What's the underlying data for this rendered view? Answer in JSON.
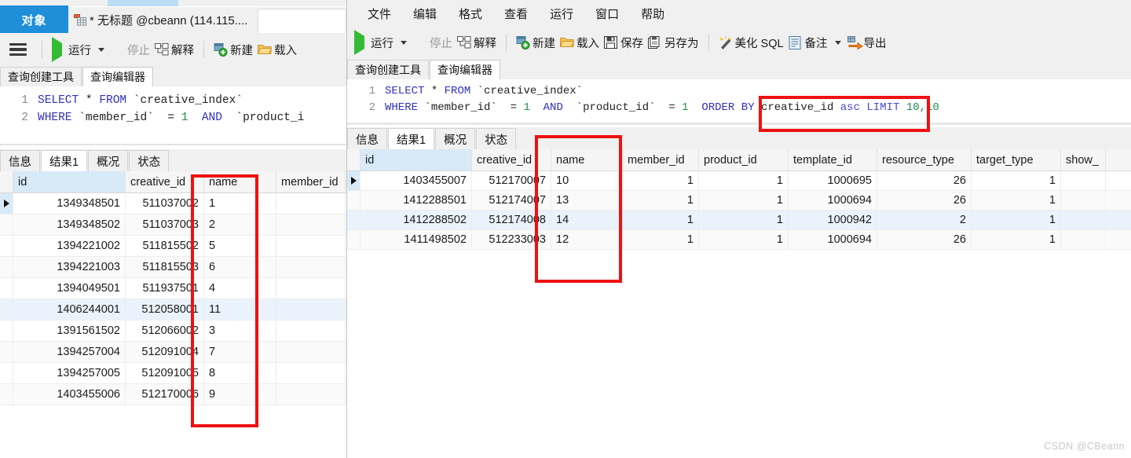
{
  "left_window": {
    "tabs": {
      "object_tab": "对象",
      "connection_tab": "* 无标题 @cbeann (114.115...."
    },
    "toolbar": {
      "menu_icon": "hamburger-icon",
      "run": "运行",
      "stop": "停止",
      "explain": "解释",
      "new": "新建",
      "load": "载入"
    },
    "subtabs": [
      {
        "label": "查询创建工具",
        "active": false
      },
      {
        "label": "查询编辑器",
        "active": true
      }
    ],
    "editor": {
      "lines": [
        {
          "n": "1",
          "tokens": [
            {
              "t": "SELECT",
              "c": "kw"
            },
            {
              "t": " * ",
              "c": "plain"
            },
            {
              "t": "FROM",
              "c": "kw"
            },
            {
              "t": " `creative_index`",
              "c": "ident"
            }
          ]
        },
        {
          "n": "2",
          "tokens": [
            {
              "t": "WHERE",
              "c": "kw"
            },
            {
              "t": " `member_id`  = ",
              "c": "ident"
            },
            {
              "t": "1",
              "c": "num"
            },
            {
              "t": "  ",
              "c": "plain"
            },
            {
              "t": "AND",
              "c": "kw"
            },
            {
              "t": "  `product_i",
              "c": "ident"
            }
          ]
        }
      ]
    },
    "result_tabs": [
      {
        "label": "信息",
        "active": false
      },
      {
        "label": "结果1",
        "active": true
      },
      {
        "label": "概况",
        "active": false
      },
      {
        "label": "状态",
        "active": false
      }
    ],
    "grid": {
      "columns": [
        "id",
        "creative_id",
        "name",
        "member_id"
      ],
      "rows": [
        [
          "1349348501",
          "511037002",
          "1",
          ""
        ],
        [
          "1349348502",
          "511037003",
          "2",
          ""
        ],
        [
          "1394221002",
          "511815502",
          "5",
          ""
        ],
        [
          "1394221003",
          "511815503",
          "6",
          ""
        ],
        [
          "1394049501",
          "511937501",
          "4",
          ""
        ],
        [
          "1406244001",
          "512058001",
          "11",
          ""
        ],
        [
          "1391561502",
          "512066002",
          "3",
          ""
        ],
        [
          "1394257004",
          "512091004",
          "7",
          ""
        ],
        [
          "1394257005",
          "512091005",
          "8",
          ""
        ],
        [
          "1403455006",
          "512170006",
          "9",
          ""
        ]
      ]
    }
  },
  "right_window": {
    "menus": [
      "文件",
      "编辑",
      "格式",
      "查看",
      "运行",
      "窗口",
      "帮助"
    ],
    "toolbar": {
      "run": "运行",
      "stop": "停止",
      "explain": "解释",
      "new": "新建",
      "load": "载入",
      "save": "保存",
      "save_as": "另存为",
      "beautify": "美化 SQL",
      "remark": "备注",
      "export": "导出"
    },
    "subtabs": [
      {
        "label": "查询创建工具",
        "active": false
      },
      {
        "label": "查询编辑器",
        "active": true
      }
    ],
    "editor": {
      "lines": [
        {
          "n": "1",
          "tokens": [
            {
              "t": "SELECT",
              "c": "kw"
            },
            {
              "t": " * ",
              "c": "plain"
            },
            {
              "t": "FROM",
              "c": "kw"
            },
            {
              "t": " `creative_index`",
              "c": "ident"
            }
          ]
        },
        {
          "n": "2",
          "tokens": [
            {
              "t": "WHERE",
              "c": "kw"
            },
            {
              "t": " `member_id`  = ",
              "c": "ident"
            },
            {
              "t": "1",
              "c": "num"
            },
            {
              "t": "  ",
              "c": "plain"
            },
            {
              "t": "AND",
              "c": "kw"
            },
            {
              "t": "  `product_id`  = ",
              "c": "ident"
            },
            {
              "t": "1",
              "c": "num"
            },
            {
              "t": "  ",
              "c": "plain"
            },
            {
              "t": "ORDER BY",
              "c": "kw"
            },
            {
              "t": " creative_id ",
              "c": "ident"
            },
            {
              "t": "asc",
              "c": "kw2"
            },
            {
              "t": " ",
              "c": "plain"
            },
            {
              "t": "LIMIT",
              "c": "kw2"
            },
            {
              "t": " ",
              "c": "plain"
            },
            {
              "t": "10,10",
              "c": "num"
            }
          ]
        }
      ]
    },
    "result_tabs": [
      {
        "label": "信息",
        "active": false
      },
      {
        "label": "结果1",
        "active": true
      },
      {
        "label": "概况",
        "active": false
      },
      {
        "label": "状态",
        "active": false
      }
    ],
    "grid": {
      "columns": [
        "id",
        "creative_id",
        "name",
        "member_id",
        "product_id",
        "template_id",
        "resource_type",
        "target_type",
        "show_"
      ],
      "rows": [
        [
          "1403455007",
          "512170007",
          "10",
          "1",
          "1",
          "1000695",
          "26",
          "1",
          ""
        ],
        [
          "1412288501",
          "512174007",
          "13",
          "1",
          "1",
          "1000694",
          "26",
          "1",
          ""
        ],
        [
          "1412288502",
          "512174008",
          "14",
          "1",
          "1",
          "1000942",
          "2",
          "1",
          ""
        ],
        [
          "1411498502",
          "512233003",
          "12",
          "1",
          "1",
          "1000694",
          "26",
          "1",
          ""
        ]
      ]
    }
  },
  "watermark": "CSDN @CBeann",
  "colors": {
    "accent_blue": "#1e8fd8",
    "annotation_red": "#ee1111",
    "selected_header": "#d8eaf8"
  }
}
